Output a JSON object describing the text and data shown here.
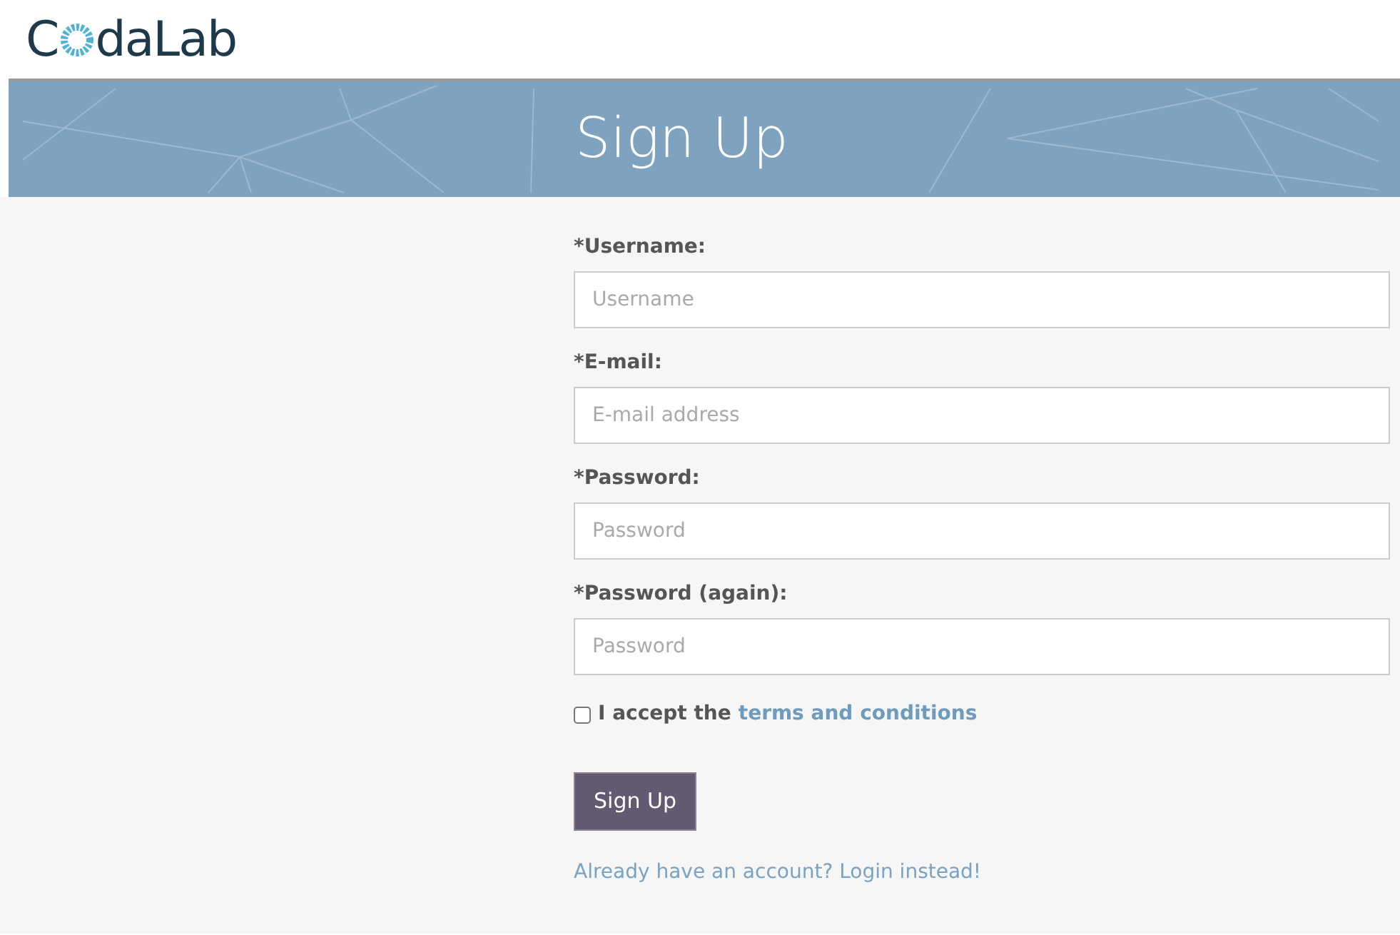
{
  "logo": {
    "prefix": "C",
    "suffix": "daLab"
  },
  "banner": {
    "title": "Sign Up"
  },
  "fields": [
    {
      "label": "*Username:",
      "placeholder": "Username"
    },
    {
      "label": "*E-mail:",
      "placeholder": "E-mail address"
    },
    {
      "label": "*Password:",
      "placeholder": "Password"
    },
    {
      "label": "*Password (again):",
      "placeholder": "Password"
    }
  ],
  "terms": {
    "checked": false,
    "text": "I accept the",
    "link": "terms and conditions"
  },
  "submit": "Sign Up",
  "login_link": "Already have an account? Login instead!"
}
